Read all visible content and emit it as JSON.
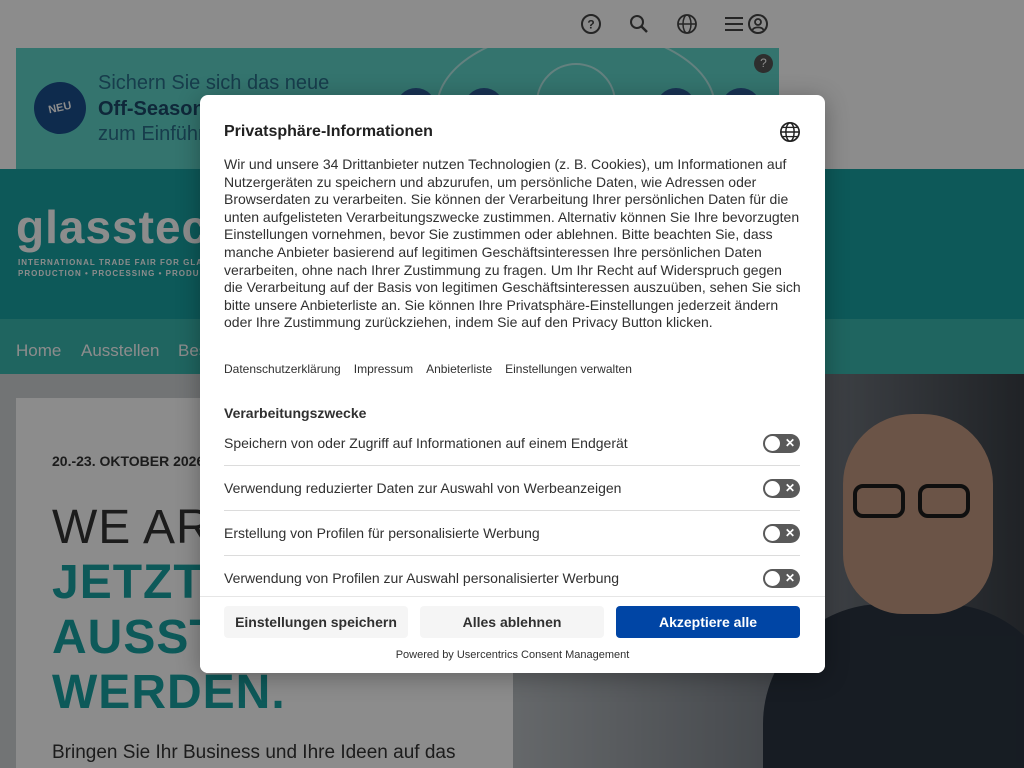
{
  "topbar": {
    "icons": [
      "help-icon",
      "search-icon",
      "globe-icon",
      "menu-icon",
      "user-icon"
    ]
  },
  "banner": {
    "badge": "NEU",
    "line1": "Sichern Sie sich das neue",
    "line2": "Off-Season",
    "line3": "zum Einführ"
  },
  "logo": {
    "text": "glasstec",
    "sub1": "INTERNATIONAL TRADE FAIR FOR GLA",
    "sub2": "PRODUCTION • PROCESSING • PRODU"
  },
  "nav": [
    "Home",
    "Ausstellen",
    "Bes"
  ],
  "hero": {
    "date": "20.-23. OKTOBER 2026",
    "line1": "WE ARE",
    "line2": "JETZT",
    "line3": "AUSST",
    "line4": "WERDEN.",
    "paragraph": "Bringen Sie Ihr Business und Ihre Ideen auf das"
  },
  "consent": {
    "title": "Privatsphäre-Informationen",
    "description": "Wir und unsere 34 Drittanbieter nutzen Technologien (z. B. Cookies), um Informationen auf Nutzergeräten zu speichern und abzurufen, um persönliche Daten, wie Adressen oder Browserdaten zu verarbeiten. Sie können der Verarbeitung Ihrer persönlichen Daten für die unten aufgelisteten Verarbeitungszwecke zustimmen. Alternativ können Sie Ihre bevorzugten Einstellungen vornehmen, bevor Sie zustimmen oder ablehnen. Bitte beachten Sie, dass manche Anbieter basierend auf legitimen Geschäftsinteressen Ihre persönlichen Daten verarbeiten, ohne nach Ihrer Zustimmung zu fragen. Um Ihr Recht auf Widerspruch gegen die Verarbeitung auf der Basis von legitimen Geschäftsinteressen auszuüben, sehen Sie sich bitte unsere Anbieterliste an. Sie können Ihre Privatsphäre-Einstellungen jederzeit ändern oder Ihre Zustimmung zurückziehen, indem Sie auf den Privacy Button klicken.",
    "links": [
      "Datenschutzerklärung",
      "Impressum",
      "Anbieterliste",
      "Einstellungen verwalten"
    ],
    "section_title": "Verarbeitungszwecke",
    "purposes": [
      {
        "label": "Speichern von oder Zugriff auf Informationen auf einem Endgerät",
        "enabled": false
      },
      {
        "label": "Verwendung reduzierter Daten zur Auswahl von Werbeanzeigen",
        "enabled": false
      },
      {
        "label": "Erstellung von Profilen für personalisierte Werbung",
        "enabled": false
      },
      {
        "label": "Verwendung von Profilen zur Auswahl personalisierter Werbung",
        "enabled": false
      }
    ],
    "buttons": {
      "save": "Einstellungen speichern",
      "deny": "Alles ablehnen",
      "accept": "Akzeptiere alle"
    },
    "powered_by": "Powered by Usercentrics Consent Management",
    "accent_color": "#0045a5"
  }
}
